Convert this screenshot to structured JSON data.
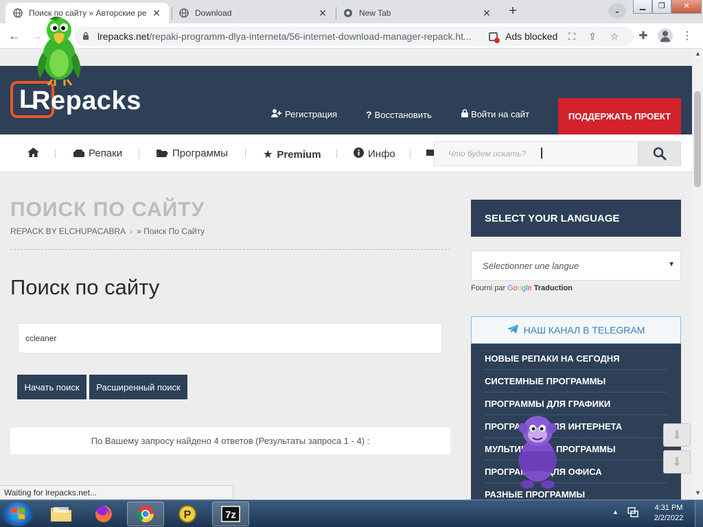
{
  "browser": {
    "tabs": [
      {
        "title": "Поиск по сайту » Авторские ре",
        "active": true
      },
      {
        "title": "Download",
        "active": false
      },
      {
        "title": "New Tab",
        "active": false
      }
    ],
    "url_host": "lrepacks.net",
    "url_path": "/repaki-programm-dlya-interneta/56-internet-download-manager-repack.ht...",
    "ads_blocked": "Ads blocked",
    "status_text": "Waiting for lrepacks.net..."
  },
  "site": {
    "logo_L": "L",
    "logo_text": "Repacks",
    "header_links": {
      "register": "Регистрация",
      "restore": "Восстановить",
      "login": "Войти на сайт"
    },
    "support_button": "ПОДДЕРЖАТЬ ПРОЕКТ",
    "nav": {
      "repacks": "Репаки",
      "programs": "Программы",
      "premium": "Premium",
      "info": "Инфо"
    },
    "search_placeholder": "Что будем искать?"
  },
  "main": {
    "page_heading": "ПОИСК ПО САЙТУ",
    "breadcrumb_home": "REPACK BY ELCHUPACABRA",
    "breadcrumb_current": "» Поиск По Сайту",
    "search_title": "Поиск по сайту",
    "query_value": "ccleaner",
    "start_search_button": "Начать поиск",
    "advanced_search_button": "Расширенный поиск",
    "results_text": "По Вашему запросу найдено 4 ответов (Результаты запроса 1 - 4) :"
  },
  "sidebar": {
    "language_heading": "SELECT YOUR LANGUAGE",
    "language_select": "Sélectionner une langue",
    "powered_prefix": "Fourni par",
    "powered_google": "Google",
    "powered_suffix": "Traduction",
    "telegram_heading": "НАШ КАНАЛ В TELEGRAM",
    "categories": [
      "НОВЫЕ РЕПАКИ НА СЕГОДНЯ",
      "СИСТЕМНЫЕ ПРОГРАММЫ",
      "ПРОГРАММЫ ДЛЯ ГРАФИКИ",
      "ПРОГРАММЫ ДЛЯ ИНТЕРНЕТА",
      "МУЛЬТИМЕДИА ПРОГРАММЫ",
      "ПРОГРАММЫ ДЛЯ ОФИСА",
      "РАЗНЫЕ ПРОГРАММЫ"
    ]
  },
  "taskbar": {
    "time": "4:31 PM",
    "date": "2/2/2022"
  },
  "colors": {
    "header_bg": "#2e4057",
    "accent_orange": "#e8572c",
    "support_red": "#d3222c"
  }
}
